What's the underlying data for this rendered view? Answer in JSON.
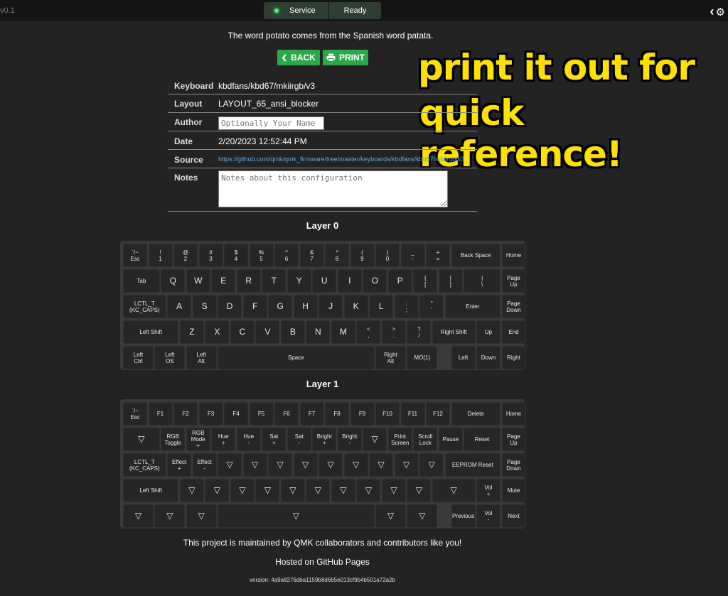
{
  "app": {
    "version_fragment": "v0.1"
  },
  "status": {
    "service_label": "Service",
    "state_label": "Ready",
    "led_color": "#41ff6a"
  },
  "top_icons": {
    "collapse": "‹",
    "settings": "⚙"
  },
  "fact": "The word potato comes from the Spanish word patata.",
  "buttons": {
    "back_label": "BACK",
    "print_label": "PRINT",
    "accent": "#2ba84a"
  },
  "overlay": {
    "line1": "print it out for",
    "line2": "quick reference!"
  },
  "info": {
    "keyboard_label": "Keyboard",
    "keyboard_value": "kbdfans/kbd67/mkiirgb/v3",
    "layout_label": "Layout",
    "layout_value": "LAYOUT_65_ansi_blocker",
    "author_label": "Author",
    "author_placeholder": "Optionally Your Name",
    "date_label": "Date",
    "date_value": "2/20/2023 12:52:44 PM",
    "source_label": "Source",
    "source_value": "https://github.com/qmk/qmk_firmware/tree/master/keyboards/kbdfans/kbd67/mkiirgb/v3",
    "notes_label": "Notes",
    "notes_placeholder": "Notes about this configuration"
  },
  "layers": [
    {
      "title": "Layer 0",
      "rows": [
        [
          [
            "`/~",
            "Esc"
          ],
          [
            "!",
            "1"
          ],
          [
            "@",
            "2"
          ],
          [
            "#",
            "3"
          ],
          [
            "$",
            "4"
          ],
          [
            "%",
            "5"
          ],
          [
            "^",
            "6"
          ],
          [
            "&",
            "7"
          ],
          [
            "*",
            "8"
          ],
          [
            "(",
            "9"
          ],
          [
            ")",
            "0"
          ],
          [
            "_",
            "-"
          ],
          [
            "+",
            "="
          ],
          [
            "Back Space"
          ],
          [
            "Home"
          ]
        ],
        [
          [
            "Tab"
          ],
          [
            "Q"
          ],
          [
            "W"
          ],
          [
            "E"
          ],
          [
            "R"
          ],
          [
            "T"
          ],
          [
            "Y"
          ],
          [
            "U"
          ],
          [
            "I"
          ],
          [
            "O"
          ],
          [
            "P"
          ],
          [
            "{",
            "["
          ],
          [
            "}",
            "]"
          ],
          [
            "|",
            "\\"
          ],
          [
            "Page",
            "Up"
          ]
        ],
        [
          [
            "LCTL_T",
            "(KC_CAPS)"
          ],
          [
            "A"
          ],
          [
            "S"
          ],
          [
            "D"
          ],
          [
            "F"
          ],
          [
            "G"
          ],
          [
            "H"
          ],
          [
            "J"
          ],
          [
            "K"
          ],
          [
            "L"
          ],
          [
            ":",
            ";"
          ],
          [
            "\"",
            "'"
          ],
          [
            "Enter"
          ],
          [
            "Page",
            "Down"
          ]
        ],
        [
          [
            "Left Shift"
          ],
          [
            "Z"
          ],
          [
            "X"
          ],
          [
            "C"
          ],
          [
            "V"
          ],
          [
            "B"
          ],
          [
            "N"
          ],
          [
            "M"
          ],
          [
            "<",
            ","
          ],
          [
            ">",
            "."
          ],
          [
            "?",
            "/"
          ],
          [
            "Right Shift"
          ],
          [
            "Up"
          ],
          [
            "End"
          ]
        ],
        [
          [
            "Left",
            "Ctrl"
          ],
          [
            "Left",
            "OS"
          ],
          [
            "Left",
            "Alt"
          ],
          [
            "Space"
          ],
          [
            "Right",
            "Alt"
          ],
          [
            "MO(1)"
          ],
          [
            "Left"
          ],
          [
            "Down"
          ],
          [
            "Right"
          ]
        ]
      ]
    },
    {
      "title": "Layer 1",
      "rows": [
        [
          [
            "`/~",
            "Esc"
          ],
          [
            "F1"
          ],
          [
            "F2"
          ],
          [
            "F3"
          ],
          [
            "F4"
          ],
          [
            "F5"
          ],
          [
            "F6"
          ],
          [
            "F7"
          ],
          [
            "F8"
          ],
          [
            "F9"
          ],
          [
            "F10"
          ],
          [
            "F11"
          ],
          [
            "F12"
          ],
          [
            "Delete"
          ],
          [
            "Home"
          ]
        ],
        [
          [
            "▽"
          ],
          [
            "RGB",
            "Toggle"
          ],
          [
            "RGB",
            "Mode",
            "+"
          ],
          [
            "Hue",
            "+"
          ],
          [
            "Hue",
            "-"
          ],
          [
            "Sat",
            "+"
          ],
          [
            "Sat",
            "-"
          ],
          [
            "Bright",
            "+"
          ],
          [
            "Bright",
            "-"
          ],
          [
            "▽"
          ],
          [
            "Print",
            "Screen"
          ],
          [
            "Scroll",
            "Lock"
          ],
          [
            "Pause"
          ],
          [
            "Reset"
          ],
          [
            "Page",
            "Up"
          ]
        ],
        [
          [
            "LCTL_T",
            "(KC_CAPS)"
          ],
          [
            "Effect",
            "+"
          ],
          [
            "Effect",
            "-"
          ],
          [
            "▽"
          ],
          [
            "▽"
          ],
          [
            "▽"
          ],
          [
            "▽"
          ],
          [
            "▽"
          ],
          [
            "▽"
          ],
          [
            "▽"
          ],
          [
            "▽"
          ],
          [
            "▽"
          ],
          [
            "EEPROM Reset"
          ],
          [
            "Page",
            "Down"
          ]
        ],
        [
          [
            "Left Shift"
          ],
          [
            "▽"
          ],
          [
            "▽"
          ],
          [
            "▽"
          ],
          [
            "▽"
          ],
          [
            "▽"
          ],
          [
            "▽"
          ],
          [
            "▽"
          ],
          [
            "▽"
          ],
          [
            "▽"
          ],
          [
            "▽"
          ],
          [
            "▽"
          ],
          [
            "Vol",
            "+"
          ],
          [
            "Mute"
          ]
        ],
        [
          [
            "▽"
          ],
          [
            "▽"
          ],
          [
            "▽"
          ],
          [
            "▽"
          ],
          [
            "▽"
          ],
          [
            "▽"
          ],
          [
            "Previous"
          ],
          [
            "Vol",
            "-"
          ],
          [
            "Next"
          ]
        ]
      ]
    }
  ],
  "footer": {
    "maintained": "This project is maintained by QMK collaborators and contributors like you!",
    "hosted": "Hosted on GitHub Pages",
    "version": "version: 4a9a8276dba1159b8d6b5e013cf9b4b501a72a2b"
  }
}
